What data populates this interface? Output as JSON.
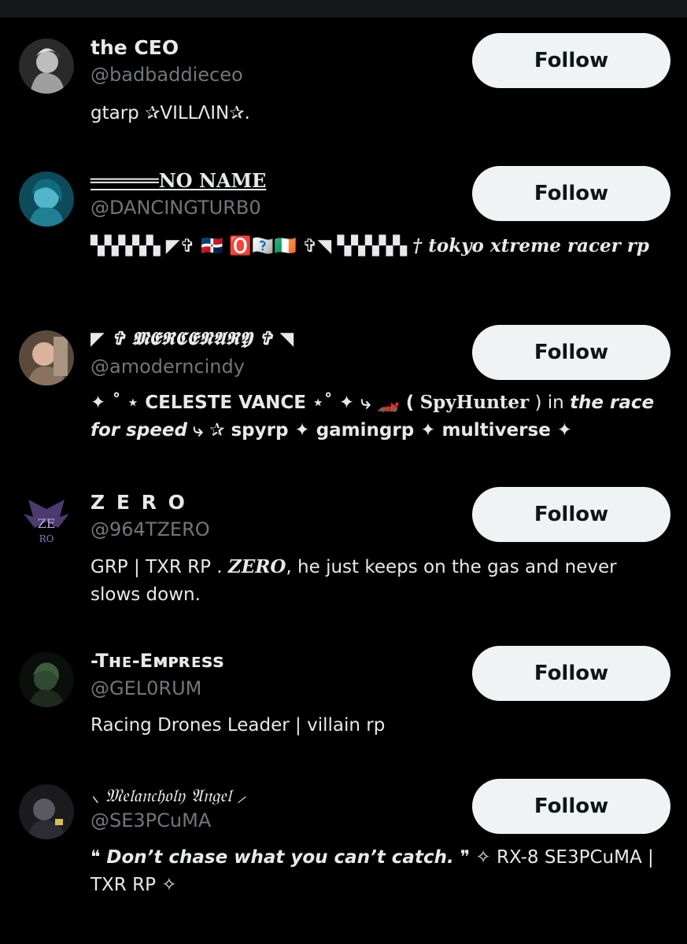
{
  "users": [
    {
      "name": "the CEO",
      "handle": "@badbaddieceo",
      "bio": "gtarp ✰VILLΛIN✰.",
      "follow_label": "Follow"
    },
    {
      "name": "══════NO NAME",
      "handle": "@DANCINGTURB0",
      "bio_part1": "▚▚▚▚▚ ◤✞ 🇩🇴 🅾️🇷🇩🇮🇪 ✞◥ ▚▚▚▚▚",
      "bio_part2": "† tokyo xtreme racer rp",
      "follow_label": "Follow"
    },
    {
      "name": "◤ ✞ 𝕸𝕰𝕽𝕮𝕰𝕹𝕬𝕽𝖄 ✞ ◥",
      "handle": "@amoderncindy",
      "bio_part1": "✦ ˚ ⋆ CELESTE VANCE ⋆˚ ✦ ⤷ 🏎️ (",
      "bio_part2": "SpyHunter",
      "bio_part3": ") in",
      "bio_part4": "the race for speed",
      "bio_part5": "⤷ ✰ spyrp ✦ gamingrp ✦ multiverse ✦",
      "follow_label": "Follow"
    },
    {
      "name": "Z E R O",
      "handle": "@964TZERO",
      "bio_part1": "GRP | TXR RP .",
      "bio_part2": "ZERO",
      "bio_part3": ", he just keeps on the gas and never slows down.",
      "follow_label": "Follow"
    },
    {
      "name": "-Tʜᴇ-Eᴍᴘʀᴇss",
      "handle": "@GEL0RUM",
      "bio": "Racing Drones Leader | villain rp",
      "follow_label": "Follow"
    },
    {
      "name": "⸜ 𝔐𝔢𝔩𝔞𝔫𝔠𝔥𝔬𝔩𝔶 𝔄𝔫𝔤𝔢𝔩 ⸝",
      "handle": "@SE3PCuMA",
      "bio_part1": "❝ Don’t chase what you can’t catch. ❞",
      "bio_part2": "✧ RX-8 SE3PCuMA | TXR RP ✧",
      "follow_label": "Follow"
    }
  ]
}
